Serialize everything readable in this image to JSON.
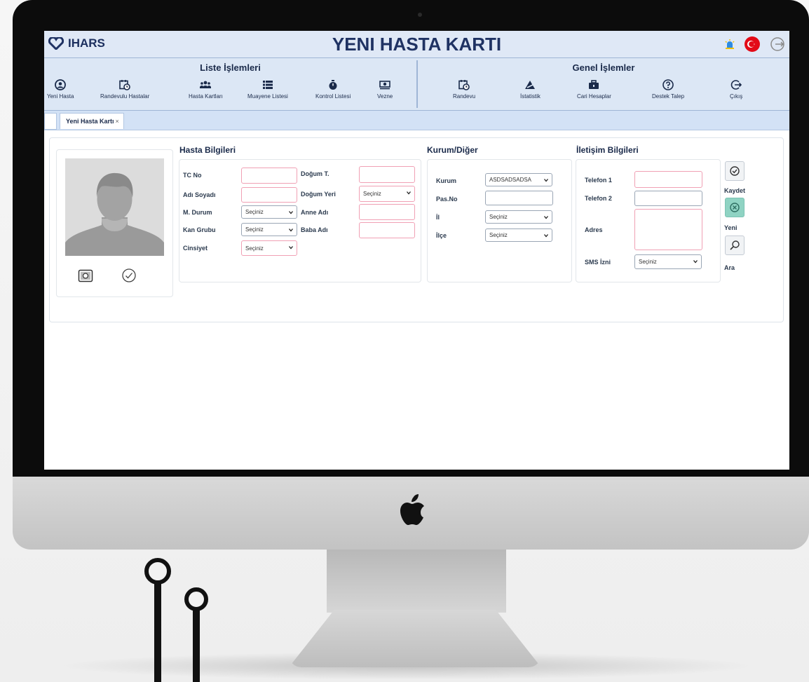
{
  "app": {
    "brand": "IHARS",
    "title": "YENI HASTA KARTI"
  },
  "toolbar": {
    "list_group_title": "Liste İşlemleri",
    "general_group_title": "Genel İşlemler",
    "list_buttons": [
      {
        "label": "Yeni Hasta",
        "icon": "user-circle-icon"
      },
      {
        "label": "Randevulu Hastalar",
        "icon": "calendar-clock-icon"
      },
      {
        "label": "Hasta Kartları",
        "icon": "users-icon"
      },
      {
        "label": "Muayene Listesi",
        "icon": "list-icon"
      },
      {
        "label": "Kontrol Listesi",
        "icon": "stopwatch-icon"
      },
      {
        "label": "Vezne",
        "icon": "cash-icon"
      }
    ],
    "general_buttons": [
      {
        "label": "Randevu",
        "icon": "calendar-clock-icon"
      },
      {
        "label": "İstatistik",
        "icon": "chart-icon"
      },
      {
        "label": "Cari Hesaplar",
        "icon": "briefcase-icon"
      },
      {
        "label": "Destek Talep",
        "icon": "help-icon"
      },
      {
        "label": "Çıkış",
        "icon": "logout-icon"
      }
    ]
  },
  "tabs": {
    "active_label": "Yeni Hasta Kartı",
    "close_glyph": "×"
  },
  "patient": {
    "section_title": "Hasta Bilgileri",
    "tc_label": "TC No",
    "name_label": "Adı Soyadı",
    "marital_label": "M. Durum",
    "blood_label": "Kan Grubu",
    "gender_label": "Cinsiyet",
    "birthdate_label": "Doğum T.",
    "birthplace_label": "Doğum Yeri",
    "mother_label": "Anne Adı",
    "father_label": "Baba Adı",
    "select_default": "Seçiniz"
  },
  "institution": {
    "section_title": "Kurum/Diğer",
    "kurum_label": "Kurum",
    "kurum_value": "ASDSADSADSA",
    "pasno_label": "Pas.No",
    "il_label": "İl",
    "ilce_label": "İlçe",
    "select_default": "Seçiniz"
  },
  "contact": {
    "section_title": "İletişim Bilgileri",
    "phone1_label": "Telefon 1",
    "phone2_label": "Telefon 2",
    "address_label": "Adres",
    "sms_label": "SMS İzni",
    "select_default": "Seçiniz"
  },
  "actions": {
    "save_label": "Kaydet",
    "new_label": "Yeni",
    "search_label": "Ara"
  },
  "colors": {
    "brand_navy": "#1f3263",
    "toolbar_bg": "#dce7f5",
    "required_border": "#f0a0b4",
    "new_button": "#8fd3c3"
  }
}
